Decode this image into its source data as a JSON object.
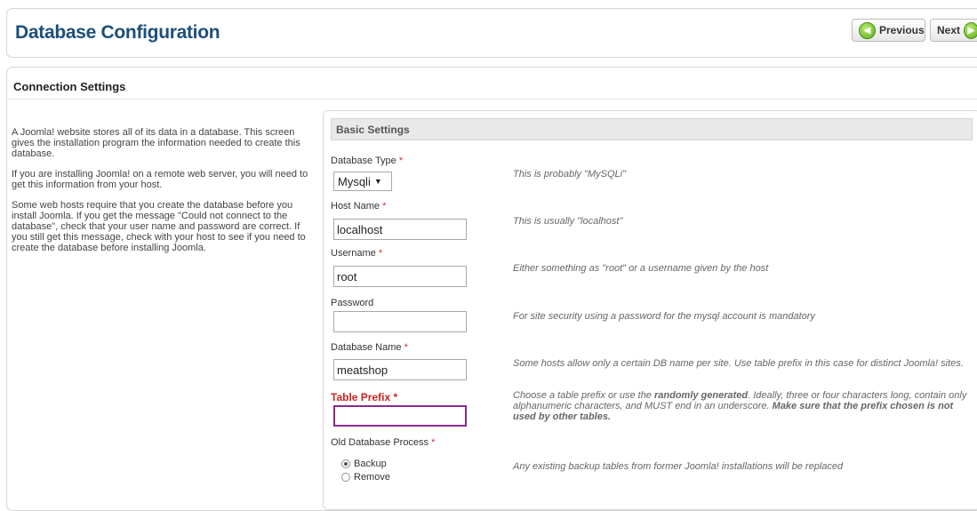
{
  "header": {
    "title": "Database Configuration",
    "previous_label": "Previous",
    "next_label": "Next",
    "prev_icon": "arrow-left-icon",
    "next_icon": "arrow-right-icon"
  },
  "connection": {
    "title": "Connection Settings",
    "intro": [
      "A Joomla! website stores all of its data in a database. This screen gives the installation program the information needed to create this database.",
      "If you are installing Joomla! on a remote web server, you will need to get this information from your host.",
      "Some web hosts require that you create the database before you install Joomla. If you get the message \"Could not connect to the database\", check that your user name and password are correct. If you still get this message, check with your host to see if you need to create the database before installing Joomla."
    ]
  },
  "basic": {
    "title": "Basic Settings",
    "required_mark": "*",
    "db_type": {
      "label": "Database Type",
      "value": "Mysqli",
      "hint": "This is probably \"MySQLi\""
    },
    "host": {
      "label": "Host Name",
      "value": "localhost",
      "hint": "This is usually \"localhost\""
    },
    "username": {
      "label": "Username",
      "value": "root",
      "hint": "Either something as \"root\" or a username given by the host"
    },
    "password": {
      "label": "Password",
      "value": "",
      "hint": "For site security using a password for the mysql account is mandatory"
    },
    "db_name": {
      "label": "Database Name",
      "value": "meatshop",
      "hint": "Some hosts allow only a certain DB name per site. Use table prefix in this case for distinct Joomla! sites."
    },
    "prefix": {
      "label": "Table Prefix",
      "value": "",
      "hint_1": "Choose a table prefix or use the ",
      "hint_bold_1": "randomly generated",
      "hint_2": ". Ideally, three or four characters long, contain only alphanumeric characters, and MUST end in an underscore. ",
      "hint_bold_2": "Make sure that the prefix chosen is not used by other tables."
    },
    "old_process": {
      "label": "Old Database Process",
      "options": [
        "Backup",
        "Remove"
      ],
      "selected": "Backup",
      "hint": "Any existing backup tables from former Joomla! installations will be replaced"
    }
  },
  "colors": {
    "title_blue": "#1b4f7a",
    "required_red": "#d03030",
    "error_border": "#8a2a8a",
    "arrow_green": "#5bae1a"
  }
}
